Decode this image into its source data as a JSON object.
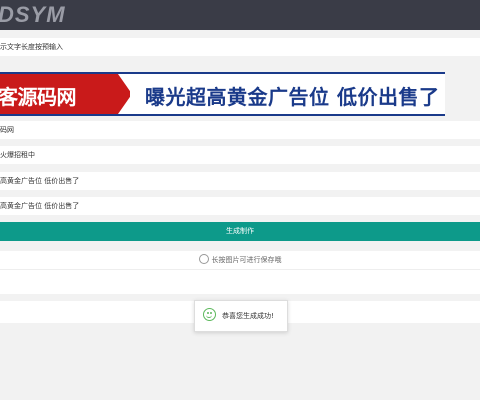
{
  "header": {
    "logo_text": "DSYM"
  },
  "fields": [
    {
      "text": "示文字长度按预输入"
    },
    {
      "text": "码网"
    },
    {
      "text": "火爆招租中"
    },
    {
      "text": "高黄金广告位 低价出售了"
    },
    {
      "text": "高黄金广告位 低价出售了"
    }
  ],
  "banner": {
    "left_text": "客源码网",
    "right_text": "曝光超高黄金广告位 低价出售了",
    "left_color": "#c91a1a",
    "right_color": "#1a3a8a"
  },
  "generate_button": {
    "label": "生成制作",
    "color": "#0d9a8a"
  },
  "hint": {
    "text": "长按图片可进行保存哦"
  },
  "toast": {
    "text": "恭喜您生成成功!",
    "icon": "smile-icon"
  }
}
